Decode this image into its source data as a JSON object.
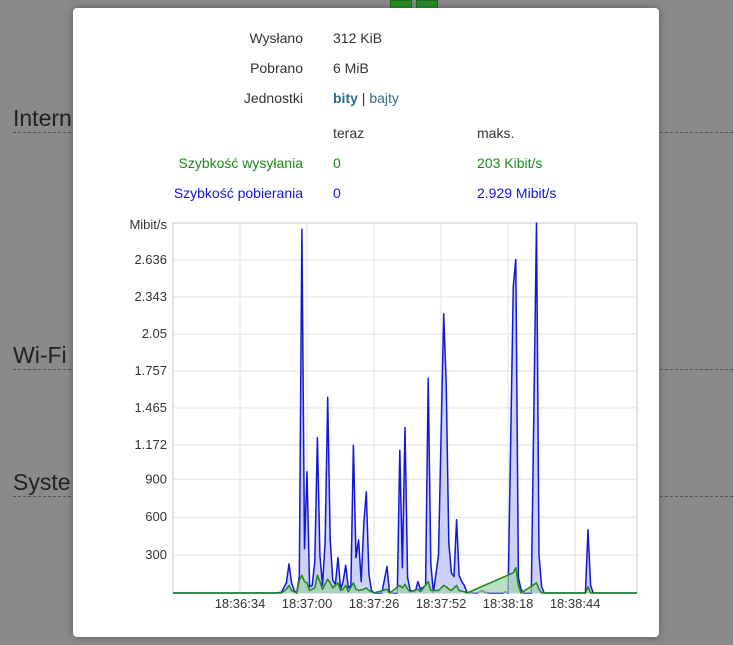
{
  "background": {
    "sections": [
      "Intern",
      "Wi-Fi",
      "Syste"
    ]
  },
  "stats": {
    "sent_label": "Wysłano",
    "sent_value": "312 KiB",
    "received_label": "Pobrano",
    "received_value": "6 MiB",
    "units_label": "Jednostki",
    "units_bits": "bity",
    "units_separator": "|",
    "units_bytes": "bajty",
    "col_now": "teraz",
    "col_max": "maks.",
    "upload_label": "Szybkość wysyłania",
    "upload_now": "0",
    "upload_max": "203 Kibit/s",
    "download_label": "Szybkość pobierania",
    "download_now": "0",
    "download_max": "2.929 Mibit/s"
  },
  "colors": {
    "upload": "#1a8a1a",
    "download": "#1515d8",
    "download_fill": "#c8ccf2"
  },
  "chart_data": {
    "type": "area",
    "ylabel": "Mibit/s",
    "yticks": [
      "300",
      "600",
      "900",
      "1.172",
      "1.465",
      "1.757",
      "2.05",
      "2.343",
      "2.636"
    ],
    "xticks": [
      "18:36:34",
      "18:37:00",
      "18:37:26",
      "18:37:52",
      "18:38:18",
      "18:38:44"
    ],
    "xlim": [
      0,
      180
    ],
    "ylim": [
      0,
      2929
    ],
    "grid": true,
    "series": [
      {
        "name": "download",
        "points": [
          [
            0,
            0
          ],
          [
            39,
            0
          ],
          [
            42,
            5
          ],
          [
            44,
            80
          ],
          [
            45,
            230
          ],
          [
            46,
            80
          ],
          [
            47,
            20
          ],
          [
            48,
            0
          ],
          [
            49,
            130
          ],
          [
            50,
            2880
          ],
          [
            51,
            350
          ],
          [
            52,
            960
          ],
          [
            53,
            50
          ],
          [
            54,
            60
          ],
          [
            55,
            250
          ],
          [
            56,
            1230
          ],
          [
            57,
            300
          ],
          [
            58,
            60
          ],
          [
            59,
            400
          ],
          [
            60,
            1550
          ],
          [
            61,
            420
          ],
          [
            62,
            100
          ],
          [
            63,
            70
          ],
          [
            64,
            280
          ],
          [
            65,
            30
          ],
          [
            66,
            90
          ],
          [
            67,
            220
          ],
          [
            68,
            40
          ],
          [
            69,
            60
          ],
          [
            70,
            1170
          ],
          [
            71,
            280
          ],
          [
            72,
            420
          ],
          [
            73,
            90
          ],
          [
            74,
            550
          ],
          [
            75,
            800
          ],
          [
            76,
            150
          ],
          [
            77,
            20
          ],
          [
            78,
            0
          ],
          [
            81,
            0
          ],
          [
            83,
            210
          ],
          [
            84,
            5
          ],
          [
            86,
            0
          ],
          [
            87,
            0
          ],
          [
            88,
            1130
          ],
          [
            89,
            200
          ],
          [
            90,
            1310
          ],
          [
            91,
            120
          ],
          [
            92,
            20
          ],
          [
            94,
            10
          ],
          [
            95,
            90
          ],
          [
            96,
            30
          ],
          [
            98,
            60
          ],
          [
            99,
            1700
          ],
          [
            100,
            230
          ],
          [
            101,
            5
          ],
          [
            103,
            300
          ],
          [
            105,
            2210
          ],
          [
            106,
            1660
          ],
          [
            107,
            400
          ],
          [
            108,
            160
          ],
          [
            109,
            130
          ],
          [
            110,
            580
          ],
          [
            111,
            140
          ],
          [
            112,
            90
          ],
          [
            113,
            60
          ],
          [
            114,
            5
          ],
          [
            118,
            0
          ],
          [
            120,
            20
          ],
          [
            121,
            5
          ],
          [
            123,
            0
          ],
          [
            128,
            0
          ],
          [
            129,
            10
          ],
          [
            130,
            0
          ],
          [
            132,
            2430
          ],
          [
            133,
            2640
          ],
          [
            134,
            120
          ],
          [
            135,
            30
          ],
          [
            136,
            0
          ],
          [
            137,
            0
          ],
          [
            138,
            0
          ],
          [
            139,
            0
          ],
          [
            141,
            2929
          ],
          [
            142,
            300
          ],
          [
            143,
            50
          ],
          [
            144,
            0
          ],
          [
            160,
            0
          ],
          [
            161,
            500
          ],
          [
            162,
            60
          ],
          [
            163,
            0
          ],
          [
            180,
            0
          ]
        ]
      },
      {
        "name": "upload",
        "points": [
          [
            0,
            0
          ],
          [
            42,
            0
          ],
          [
            44,
            30
          ],
          [
            45,
            60
          ],
          [
            46,
            20
          ],
          [
            48,
            0
          ],
          [
            49,
            100
          ],
          [
            50,
            140
          ],
          [
            51,
            90
          ],
          [
            52,
            80
          ],
          [
            53,
            20
          ],
          [
            55,
            40
          ],
          [
            56,
            140
          ],
          [
            57,
            90
          ],
          [
            58,
            30
          ],
          [
            60,
            110
          ],
          [
            61,
            80
          ],
          [
            62,
            40
          ],
          [
            64,
            80
          ],
          [
            65,
            20
          ],
          [
            66,
            30
          ],
          [
            67,
            60
          ],
          [
            68,
            10
          ],
          [
            70,
            80
          ],
          [
            71,
            30
          ],
          [
            72,
            20
          ],
          [
            74,
            30
          ],
          [
            75,
            40
          ],
          [
            76,
            20
          ],
          [
            78,
            0
          ],
          [
            83,
            30
          ],
          [
            84,
            0
          ],
          [
            88,
            60
          ],
          [
            89,
            40
          ],
          [
            90,
            70
          ],
          [
            91,
            30
          ],
          [
            92,
            10
          ],
          [
            95,
            30
          ],
          [
            96,
            10
          ],
          [
            99,
            90
          ],
          [
            100,
            20
          ],
          [
            103,
            20
          ],
          [
            105,
            60
          ],
          [
            106,
            50
          ],
          [
            107,
            30
          ],
          [
            108,
            20
          ],
          [
            110,
            60
          ],
          [
            111,
            20
          ],
          [
            113,
            10
          ],
          [
            114,
            0
          ],
          [
            132,
            160
          ],
          [
            133,
            200
          ],
          [
            134,
            60
          ],
          [
            135,
            0
          ],
          [
            141,
            80
          ],
          [
            142,
            30
          ],
          [
            143,
            0
          ],
          [
            160,
            0
          ],
          [
            161,
            50
          ],
          [
            162,
            0
          ],
          [
            180,
            0
          ]
        ]
      }
    ]
  }
}
